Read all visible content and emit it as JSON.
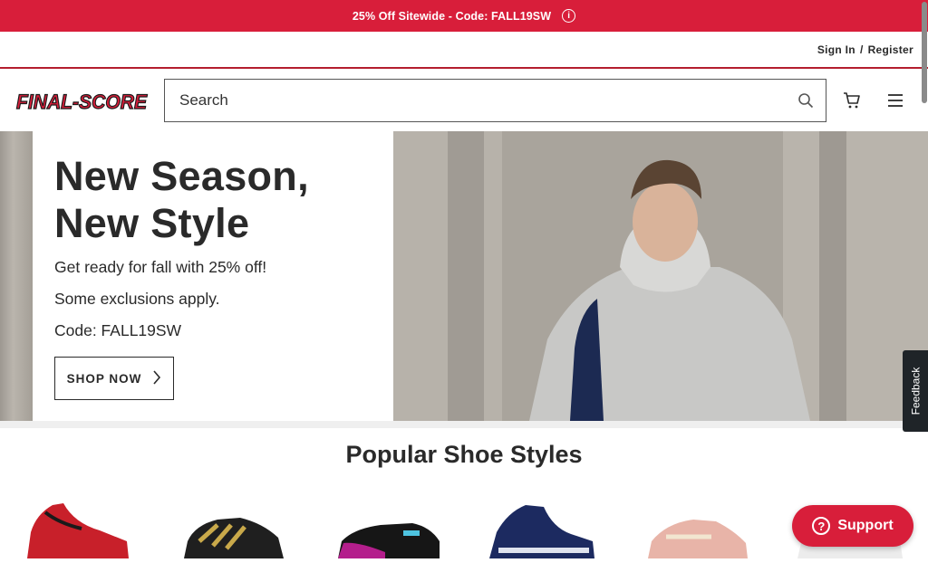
{
  "promo": {
    "text": "25% Off Sitewide - Code: FALL19SW",
    "info_icon": "info-icon"
  },
  "utility": {
    "sign_in": "Sign In",
    "separator": "/",
    "register": "Register"
  },
  "header": {
    "logo_text": "FINAL-SCORE",
    "search_placeholder": "Search",
    "search_icon": "search-icon",
    "cart_icon": "cart-icon",
    "menu_icon": "hamburger-menu-icon"
  },
  "hero": {
    "title_line1": "New Season,",
    "title_line2": "New Style",
    "line1": "Get ready for fall with 25% off!",
    "line2": "Some exclusions apply.",
    "line3": "Code: FALL19SW",
    "cta_label": "SHOP NOW"
  },
  "popular": {
    "title": "Popular Shoe Styles",
    "shoes": [
      {
        "name": "red-high-top-sneaker"
      },
      {
        "name": "black-gold-sneaker"
      },
      {
        "name": "black-purple-sneaker"
      },
      {
        "name": "navy-high-top-sneaker"
      },
      {
        "name": "pink-running-shoe"
      },
      {
        "name": "white-running-shoe"
      }
    ]
  },
  "feedback": {
    "label": "Feedback"
  },
  "support": {
    "label": "Support"
  },
  "colors": {
    "brand_red": "#d81e3a",
    "text_dark": "#2a2a2a"
  }
}
